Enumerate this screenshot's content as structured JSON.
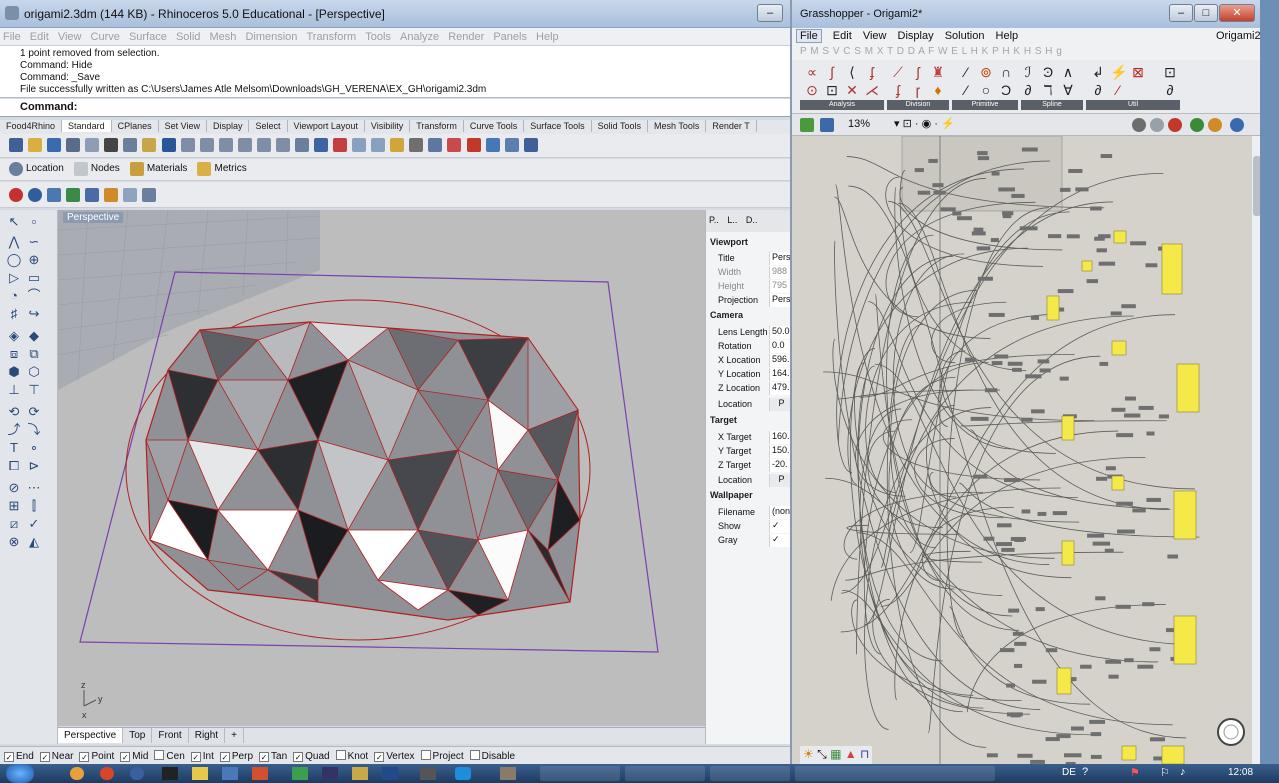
{
  "rhino": {
    "title": "origami2.3dm (144 KB) - Rhinoceros 5.0 Educational - [Perspective]",
    "menu": [
      "File",
      "Edit",
      "View",
      "Curve",
      "Surface",
      "Solid",
      "Mesh",
      "Dimension",
      "Transform",
      "Tools",
      "Analyze",
      "Render",
      "Panels",
      "Help"
    ],
    "command_history": [
      "1 point removed from selection.",
      "Command: Hide",
      "Command: _Save",
      "File successfully written as C:\\Users\\James Atle Melsom\\Downloads\\GH_VERENA\\EX_GH\\origami2.3dm"
    ],
    "command_prompt": "Command:",
    "toolbar_tabs": [
      "Food4Rhino",
      "Standard",
      "CPlanes",
      "Set View",
      "Display",
      "Select",
      "Viewport Layout",
      "Visibility",
      "Transform",
      "Curve Tools",
      "Surface Tools",
      "Solid Tools",
      "Mesh Tools",
      "Render T"
    ],
    "active_tab": "Standard",
    "sub_toolbar": [
      "Location",
      "Nodes",
      "Materials",
      "Metrics"
    ],
    "viewport_label": "Perspective",
    "viewport_tabs": [
      "Perspective",
      "Top",
      "Front",
      "Right"
    ],
    "axis_labels": {
      "z": "z",
      "y": "y",
      "x": "x"
    },
    "properties": {
      "tabs": [
        "P..",
        "L..",
        "D.."
      ],
      "sections": {
        "viewport": "Viewport",
        "camera": "Camera",
        "target": "Target",
        "wallpaper": "Wallpaper"
      },
      "viewport_rows": [
        {
          "k": "Title",
          "v": "Pers"
        },
        {
          "k": "Width",
          "v": "988"
        },
        {
          "k": "Height",
          "v": "795"
        },
        {
          "k": "Projection",
          "v": "Pers"
        }
      ],
      "camera_rows": [
        {
          "k": "Lens Length",
          "v": "50.0"
        },
        {
          "k": "Rotation",
          "v": "0.0"
        },
        {
          "k": "X Location",
          "v": "596."
        },
        {
          "k": "Y Location",
          "v": "164."
        },
        {
          "k": "Z Location",
          "v": "479."
        },
        {
          "k": "Location",
          "v": "P"
        }
      ],
      "target_rows": [
        {
          "k": "X Target",
          "v": "160."
        },
        {
          "k": "Y Target",
          "v": "150."
        },
        {
          "k": "Z Target",
          "v": "-20."
        },
        {
          "k": "Location",
          "v": "P"
        }
      ],
      "wallpaper_rows": [
        {
          "k": "Filename",
          "v": "(none"
        },
        {
          "k": "Show",
          "v": "✓"
        },
        {
          "k": "Gray",
          "v": "✓"
        }
      ]
    },
    "osnaps": [
      {
        "label": "End",
        "on": true
      },
      {
        "label": "Near",
        "on": true
      },
      {
        "label": "Point",
        "on": true
      },
      {
        "label": "Mid",
        "on": true
      },
      {
        "label": "Cen",
        "on": false
      },
      {
        "label": "Int",
        "on": true
      },
      {
        "label": "Perp",
        "on": true
      },
      {
        "label": "Tan",
        "on": true
      },
      {
        "label": "Quad",
        "on": true
      },
      {
        "label": "Knot",
        "on": false
      },
      {
        "label": "Vertex",
        "on": true
      },
      {
        "label": "Project",
        "on": false
      },
      {
        "label": "Disable",
        "on": false
      }
    ]
  },
  "grasshopper": {
    "title": "Grasshopper - Origami2*",
    "menu": [
      "File",
      "Edit",
      "View",
      "Display",
      "Solution",
      "Help"
    ],
    "doc_name": "Origami2",
    "tabs_text": "P  M  S  V  C  S  M  X  T  D  D  A  F  W  E  L  H  K  P  H  K  H  S  H  g",
    "groups": [
      "Analysis",
      "Division",
      "Primitive",
      "Spline",
      "Util"
    ],
    "zoom": "13%"
  },
  "taskbar": {
    "language": "DE",
    "clock": "12:08"
  },
  "colors": {
    "accent": "#1e3b60",
    "panel_yellow": "#f5e94a",
    "edge_red": "#b02020"
  }
}
